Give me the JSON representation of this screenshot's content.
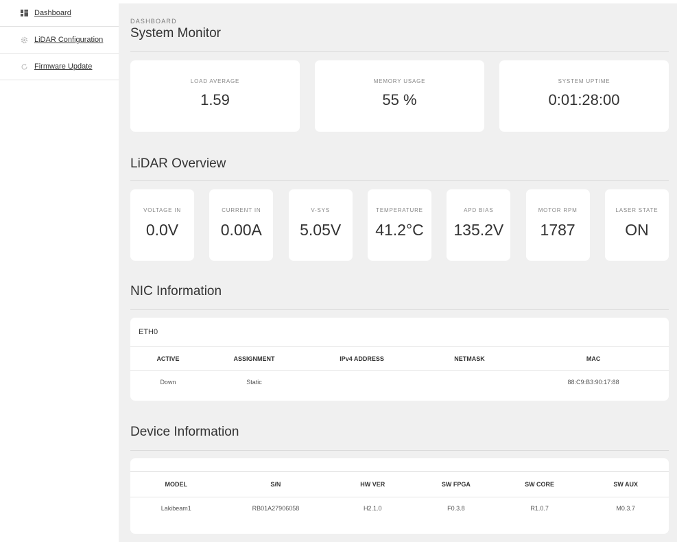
{
  "sidebar": {
    "items": [
      {
        "label": "Dashboard",
        "icon": "dashboard-icon"
      },
      {
        "label": "LiDAR Configuration",
        "icon": "gear-icon"
      },
      {
        "label": "Firmware Update",
        "icon": "refresh-icon"
      }
    ]
  },
  "header": {
    "kicker": "DASHBOARD",
    "title": "System Monitor"
  },
  "system": [
    {
      "label": "LOAD AVERAGE",
      "value": "1.59"
    },
    {
      "label": "MEMORY USAGE",
      "value": "55 %"
    },
    {
      "label": "SYSTEM UPTIME",
      "value": "0:01:28:00"
    }
  ],
  "lidar": {
    "title": "LiDAR Overview",
    "items": [
      {
        "label": "VOLTAGE IN",
        "value": "0.0V"
      },
      {
        "label": "CURRENT IN",
        "value": "0.00A"
      },
      {
        "label": "V-SYS",
        "value": "5.05V"
      },
      {
        "label": "TEMPERATURE",
        "value": "41.2°C"
      },
      {
        "label": "APD BIAS",
        "value": "135.2V"
      },
      {
        "label": "MOTOR RPM",
        "value": "1787"
      },
      {
        "label": "LASER STATE",
        "value": "ON"
      }
    ]
  },
  "nic": {
    "title": "NIC Information",
    "interface": "ETH0",
    "columns": [
      "ACTIVE",
      "ASSIGNMENT",
      "IPv4 ADDRESS",
      "NETMASK",
      "MAC"
    ],
    "row": [
      "Down",
      "Static",
      "",
      "",
      "88:C9:B3:90:17:88"
    ]
  },
  "device": {
    "title": "Device Information",
    "columns": [
      "MODEL",
      "S/N",
      "HW VER",
      "SW FPGA",
      "SW CORE",
      "SW AUX"
    ],
    "row": [
      "Lakibeam1",
      "RB01A27906058",
      "H2.1.0",
      "F0.3.8",
      "R1.0.7",
      "M0.3.7"
    ]
  },
  "colors": {
    "page_background": "#f0f0f0",
    "card_background": "#ffffff",
    "text": "#333333",
    "muted_text": "#888888",
    "divider": "#dadada"
  }
}
